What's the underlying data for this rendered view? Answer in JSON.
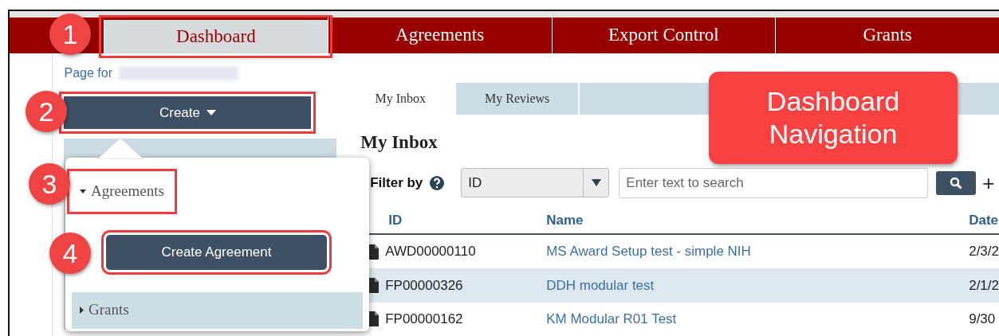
{
  "top_nav": [
    {
      "label": "Dashboard",
      "selected": true
    },
    {
      "label": "Agreements",
      "selected": false
    },
    {
      "label": "Export Control",
      "selected": false
    },
    {
      "label": "Grants",
      "selected": false
    }
  ],
  "sidebar": {
    "page_for": "Page for",
    "create_button": "Create"
  },
  "create_menu": {
    "sections": [
      {
        "label": "Agreements",
        "expanded": true,
        "selected": false,
        "items": [
          "Create Agreement"
        ]
      },
      {
        "label": "Grants",
        "expanded": false,
        "selected": true
      }
    ]
  },
  "tabs": [
    {
      "label": "My Inbox",
      "selected": true
    },
    {
      "label": "My Reviews",
      "selected": false
    }
  ],
  "heading": "My Inbox",
  "filter": {
    "label": "Filter by",
    "select_value": "ID",
    "search_placeholder": "Enter text to search",
    "add_button": "+"
  },
  "table": {
    "columns": [
      "ID",
      "Name",
      "Date"
    ],
    "rows": [
      {
        "id": "AWD00000110",
        "name": "MS Award Setup test - simple NIH",
        "date": "2/3/2",
        "selected": false
      },
      {
        "id": "FP00000326",
        "name": "DDH modular test",
        "date": "2/1/2",
        "selected": true
      },
      {
        "id": "FP00000162",
        "name": "KM Modular R01 Test",
        "date": "9/30",
        "selected": false
      }
    ]
  },
  "annotations": {
    "callout": "Dashboard Navigation",
    "steps": [
      "1",
      "2",
      "3",
      "4"
    ]
  }
}
